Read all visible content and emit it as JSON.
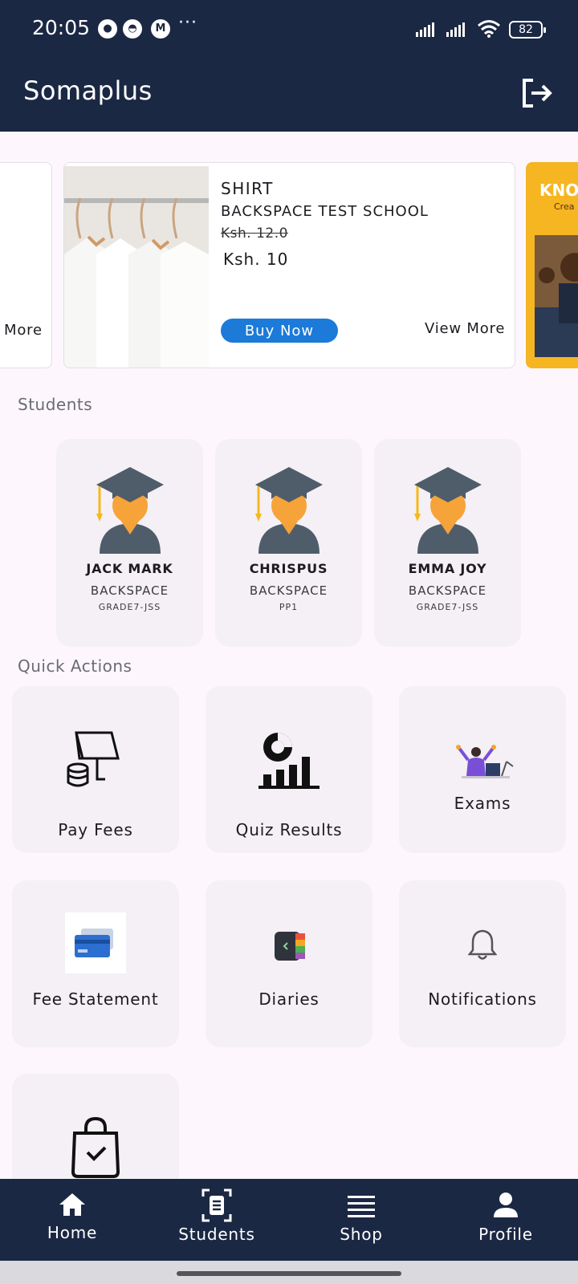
{
  "status_bar": {
    "time": "20:05",
    "notification_icons": [
      "chat-bubble-icon",
      "ghost-icon",
      "m-app-icon"
    ],
    "more": "···",
    "battery": "82"
  },
  "app_bar": {
    "title": "Somaplus",
    "logout_icon": "logout-icon"
  },
  "banners": {
    "left_partial": {
      "view_more": "More"
    },
    "main": {
      "name": "SHIRT",
      "school": "BACKSPACE TEST SCHOOL",
      "old_price": "Ksh. 12.0",
      "new_price": "Ksh. 10",
      "buy_label": "Buy Now",
      "view_more": "View More"
    },
    "right_partial": {
      "title": "KNO",
      "subtitle": "Crea"
    }
  },
  "students": {
    "title": "Students",
    "items": [
      {
        "name": "JACK MARK",
        "school": "BACKSPACE",
        "grade": "GRADE7-JSS"
      },
      {
        "name": "CHRISPUS",
        "school": "BACKSPACE",
        "grade": "PP1"
      },
      {
        "name": "EMMA JOY",
        "school": "BACKSPACE",
        "grade": "GRADE7-JSS"
      }
    ]
  },
  "quick_actions": {
    "title": "Quick Actions",
    "items": [
      {
        "label": "Pay Fees",
        "icon": "pay-fees-icon"
      },
      {
        "label": "Quiz Results",
        "icon": "quiz-results-icon"
      },
      {
        "label": "Exams",
        "icon": "exams-icon"
      },
      {
        "label": "Fee Statement",
        "icon": "fee-statement-icon"
      },
      {
        "label": "Diaries",
        "icon": "diaries-icon"
      },
      {
        "label": "Notifications",
        "icon": "bell-icon"
      },
      {
        "label": "",
        "icon": "shopping-bag-icon"
      }
    ]
  },
  "bottom_nav": {
    "items": [
      {
        "label": "Home",
        "icon": "home-icon"
      },
      {
        "label": "Students",
        "icon": "students-icon"
      },
      {
        "label": "Shop",
        "icon": "shop-icon"
      },
      {
        "label": "Profile",
        "icon": "profile-icon"
      }
    ]
  },
  "colors": {
    "primary": "#1b2844",
    "button_blue": "#1c7ad8",
    "card_bg": "#f4f0f6",
    "page_bg": "#fdf7fd"
  }
}
